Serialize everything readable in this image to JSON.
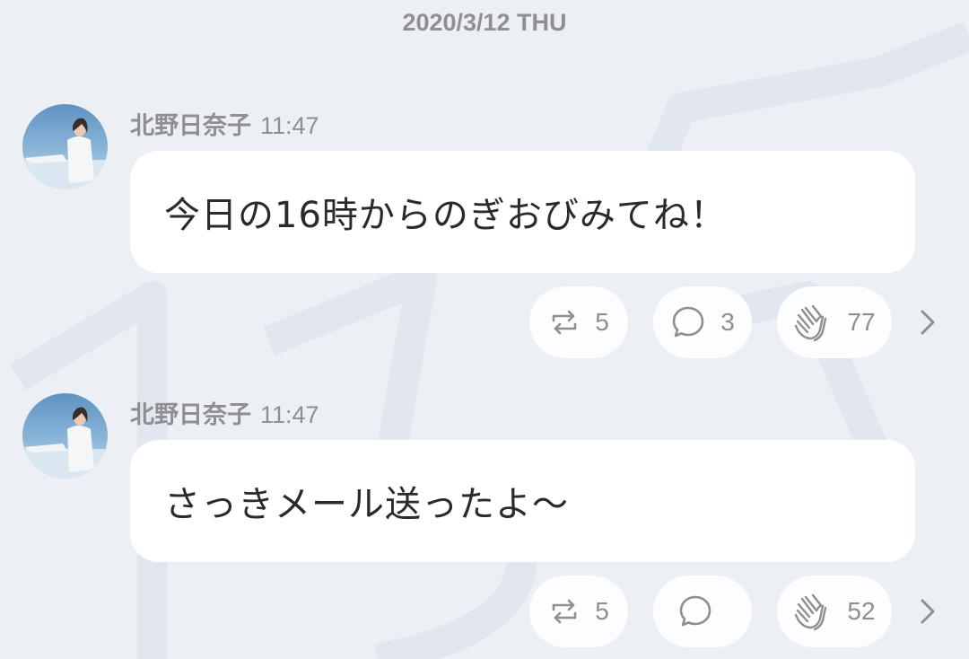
{
  "date_header": "2020/3/12 THU",
  "messages": [
    {
      "author": "北野日奈子",
      "time": "11:47",
      "text": "今日の16時からのぎおびみてね！",
      "reactions": {
        "repost": "5",
        "comment": "3",
        "clap": "77"
      }
    },
    {
      "author": "北野日奈子",
      "time": "11:47",
      "text": "さっきメール送ったよ〜",
      "reactions": {
        "repost": "5",
        "comment": "",
        "clap": "52"
      }
    }
  ],
  "icons": {
    "repost": "repost-icon",
    "comment": "comment-bubble-icon",
    "clap": "clap-hands-icon",
    "more": "chevron-right-icon"
  },
  "colors": {
    "background": "#eceff4",
    "bubble": "#ffffff",
    "meta_text": "#8e8f93",
    "message_text": "#2a2a2a"
  }
}
